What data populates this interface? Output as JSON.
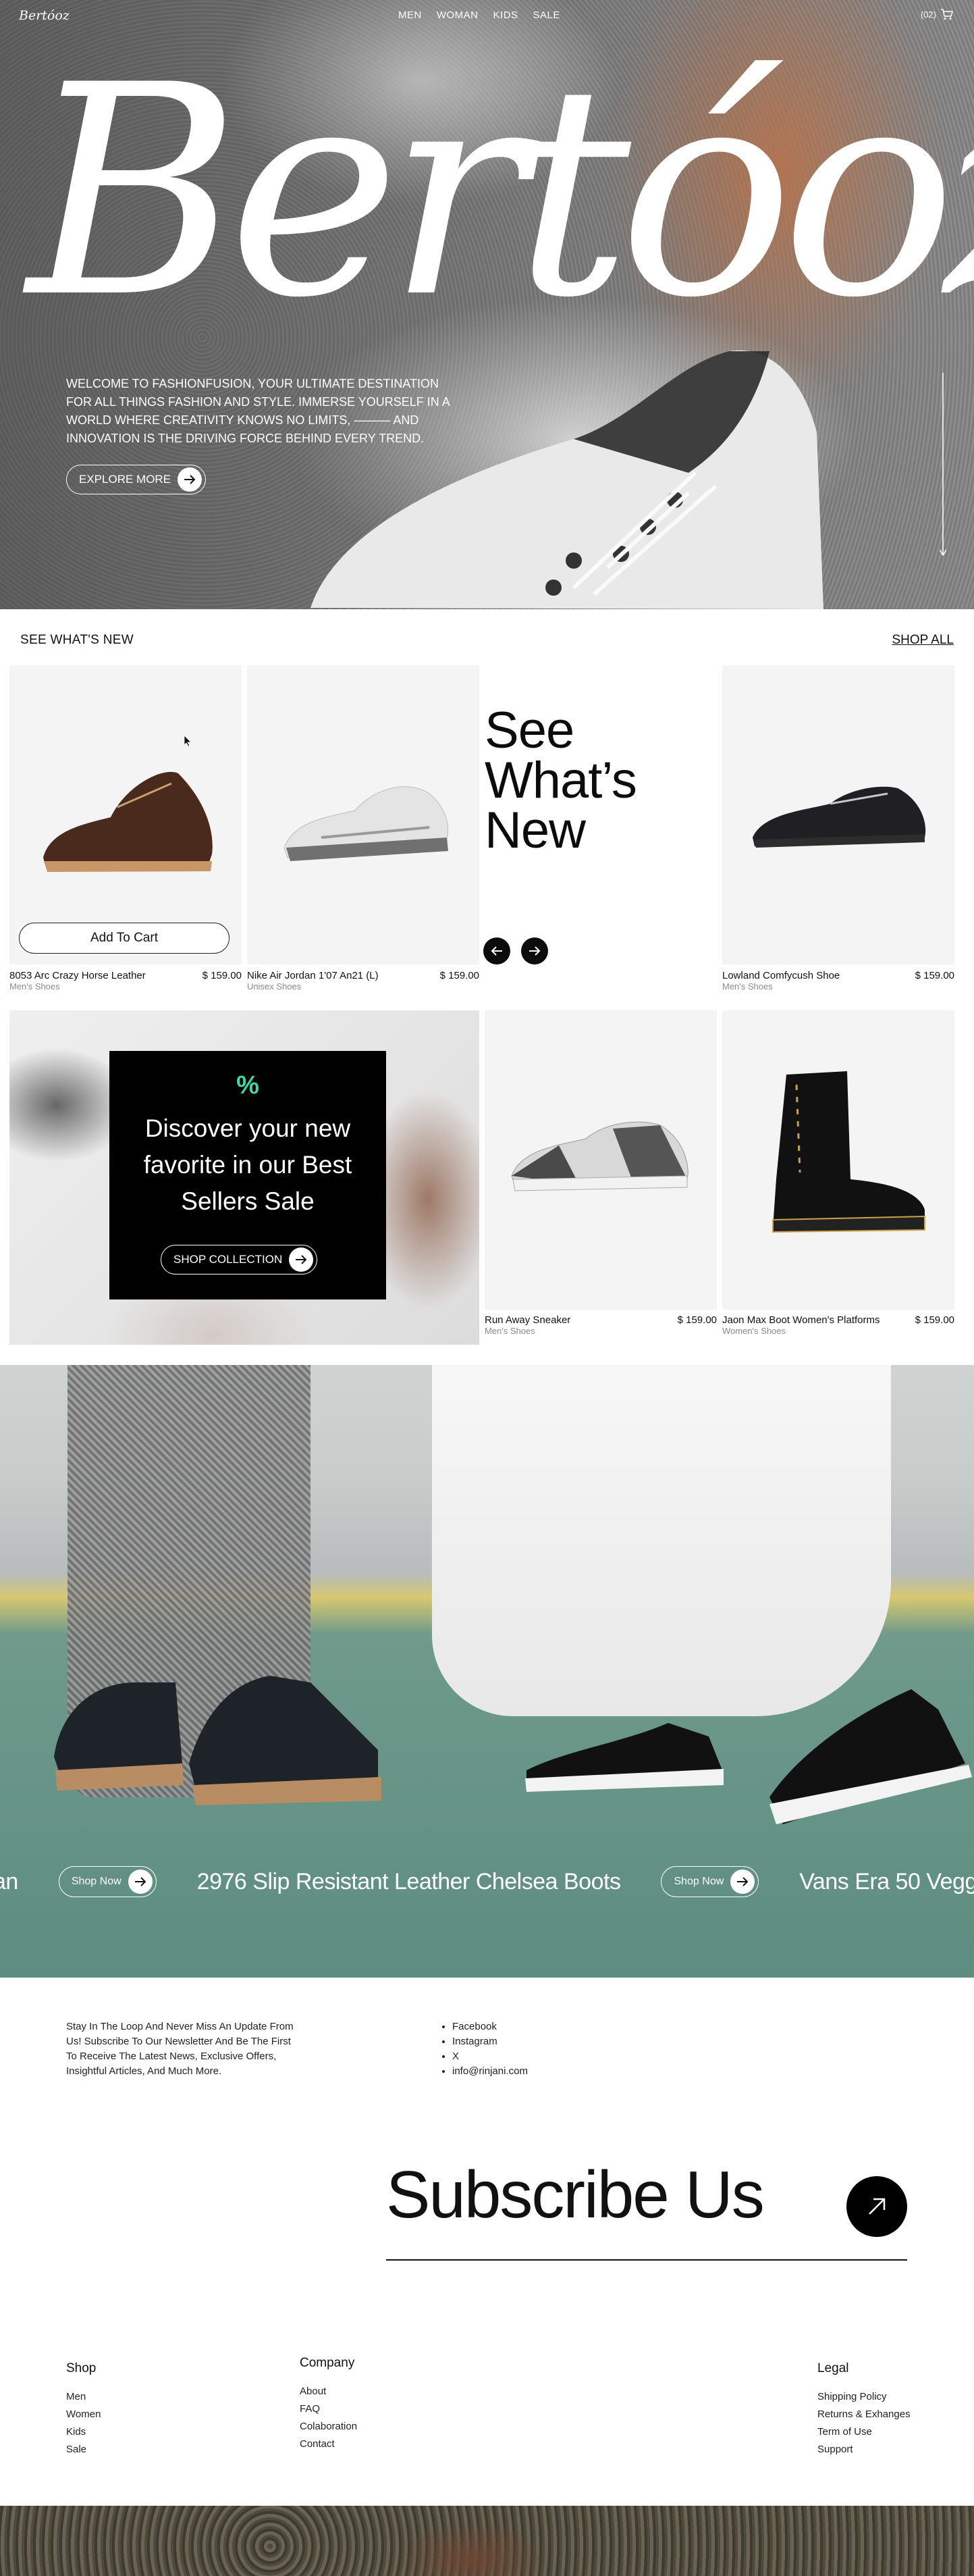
{
  "nav": {
    "logo": "Bertóoz",
    "links": [
      "MEN",
      "WOMAN",
      "KIDS",
      "SALE"
    ],
    "cart_count": "(02)"
  },
  "hero": {
    "brand": "Bertóoz",
    "text": "WELCOME TO FASHIONFUSION, YOUR ULTIMATE DESTINATION FOR ALL THINGS FASHION AND STYLE. IMMERSE YOURSELF IN A WORLD WHERE CREATIVITY KNOWS NO LIMITS, ——— AND INNOVATION IS THE DRIVING FORCE BEHIND EVERY TREND.",
    "button": "EXPLORE MORE"
  },
  "new_section": {
    "title": "SEE WHAT'S NEW",
    "shop_all": "SHOP ALL",
    "headline": [
      "See",
      "What’s",
      "New"
    ],
    "add_to_cart": "Add To Cart",
    "products": [
      {
        "name": "8053 Arc Crazy Horse Leather",
        "price": "$ 159.00",
        "category": "Men's Shoes"
      },
      {
        "name": "Nike Air Jordan 1'07  An21 (L)",
        "price": "$ 159.00",
        "category": "Unisex Shoes"
      },
      {
        "name": "Lowland Comfycush Shoe",
        "price": "$ 159.00",
        "category": "Men's Shoes"
      },
      {
        "name": "Run Away Sneaker",
        "price": "$ 159.00",
        "category": "Men's Shoes"
      },
      {
        "name": "Jaon Max Boot Women's Platforms",
        "price": "$ 159.00",
        "category": "Women's Shoes"
      }
    ]
  },
  "promo": {
    "icon": "%",
    "title": "Discover your new favorite in our Best Sellers Sale",
    "button": "SHOP COLLECTION",
    "accent": "#3fd6a6"
  },
  "banner": {
    "ticker": [
      {
        "type": "text",
        "value": "an"
      },
      {
        "type": "button",
        "value": "Shop Now"
      },
      {
        "type": "text",
        "value": "2976 Slip Resistant Leather Chelsea Boots"
      },
      {
        "type": "button",
        "value": "Shop Now"
      },
      {
        "type": "text",
        "value": "Vans Era 50 Vegg"
      }
    ]
  },
  "footer": {
    "newsletter_text": "Stay In The Loop And Never Miss An Update From Us! Subscribe To Our Newsletter And Be The First To Receive The Latest News, Exclusive Offers, Insightful Articles, And Much More.",
    "socials": [
      "Facebook",
      "Instagram",
      "X",
      "info@rinjani.com"
    ],
    "subscribe": "Subscribe Us",
    "columns": [
      {
        "title": "Shop",
        "links": [
          "Men",
          "Women",
          "Kids",
          "Sale"
        ]
      },
      {
        "title": "Company",
        "links": [
          "About",
          "FAQ",
          "Colaboration",
          "Contact"
        ]
      },
      {
        "title": "Legal",
        "links": [
          "Shipping Policy",
          "Returns & Exhanges",
          "Term of Use",
          "Support"
        ]
      }
    ]
  }
}
